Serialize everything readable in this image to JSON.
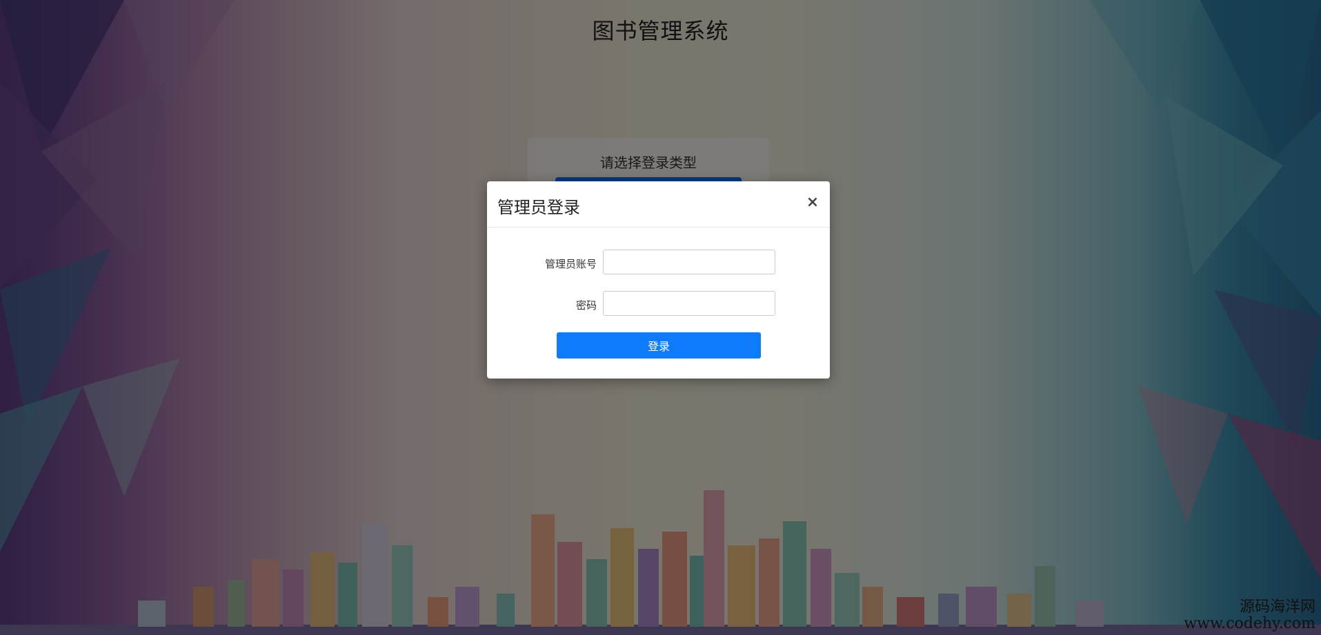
{
  "page": {
    "title": "图书管理系统"
  },
  "type_panel": {
    "title": "请选择登录类型"
  },
  "modal": {
    "title": "管理员登录",
    "close_glyph": "×",
    "fields": [
      {
        "label": "管理员账号",
        "value": "",
        "placeholder": ""
      },
      {
        "label": "密码",
        "value": "",
        "placeholder": ""
      }
    ],
    "submit_label": "登录"
  },
  "watermark": {
    "name": "源码海洋网",
    "url": "www.codehy.com"
  },
  "colors": {
    "primary": "#0d7bfa"
  }
}
